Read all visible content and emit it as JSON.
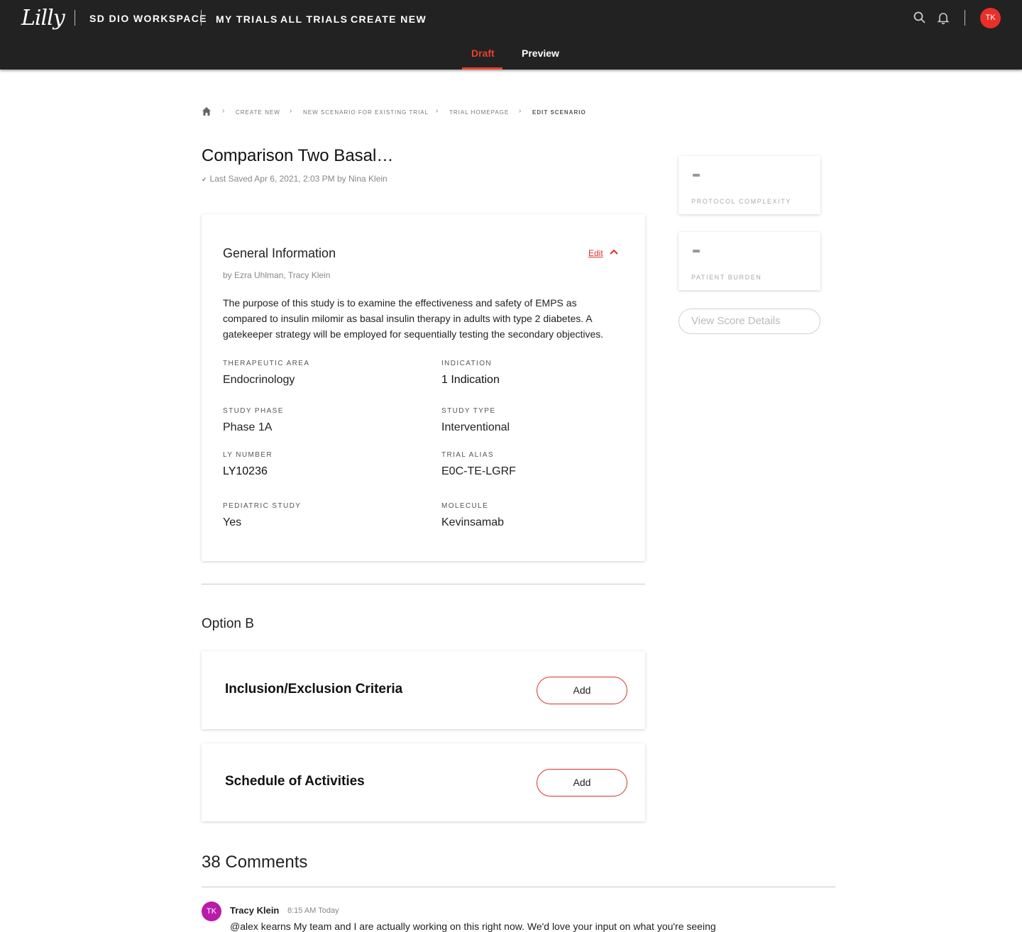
{
  "header": {
    "logo_text": "Lilly",
    "workspace": "SD DIO WORKSPACE",
    "nav": [
      "MY TRIALS",
      "ALL TRIALS",
      "CREATE NEW"
    ],
    "user_initials": "TK",
    "tabs": [
      "Draft",
      "Preview"
    ],
    "active_tab": "Draft"
  },
  "breadcrumb": [
    "CREATE NEW",
    "NEW SCENARIO FOR EXISTING TRIAL",
    "TRIAL HOMEPAGE",
    "EDIT SCENARIO"
  ],
  "page": {
    "title": "Comparison Two Basal…",
    "saved": "Last Saved Apr 6, 2021, 2:03 PM by Nina Klein"
  },
  "general_info": {
    "title": "General Information",
    "edit_label": "Edit",
    "by": "by Ezra Uhlman, Tracy Klein",
    "description": "The purpose of this study is to examine the effectiveness and safety of EMPS as compared to insulin milomir as basal insulin therapy in adults with type 2 diabetes. A gatekeeper strategy will be employed for sequentially testing the secondary objectives.",
    "fields": {
      "therapeutic_area": {
        "label": "THERAPEUTIC AREA",
        "value": "Endocrinology"
      },
      "indication": {
        "label": "INDICATION",
        "value": "1 Indication"
      },
      "study_phase": {
        "label": "STUDY PHASE",
        "value": "Phase 1A"
      },
      "study_type": {
        "label": "STUDY TYPE",
        "value": "Interventional"
      },
      "ly_number": {
        "label": "LY NUMBER",
        "value": "LY10236"
      },
      "trial_alias": {
        "label": "TRIAL ALIAS",
        "value": "E0C-TE-LGRF"
      },
      "pediatric_study": {
        "label": "PEDIATRIC STUDY",
        "value": "Yes"
      },
      "molecule": {
        "label": "MOLECULE",
        "value": "Kevinsamab"
      }
    }
  },
  "option": {
    "title": "Option B",
    "sections": [
      {
        "title": "Inclusion/Exclusion Criteria",
        "button": "Add"
      },
      {
        "title": "Schedule of Activities",
        "button": "Add"
      }
    ]
  },
  "scores": {
    "cards": [
      {
        "value": "-",
        "label": "PROTOCOL COMPLEXITY"
      },
      {
        "value": "-",
        "label": "PATIENT BURDEN"
      }
    ],
    "details_button": "View Score Details"
  },
  "comments": {
    "title": "38 Comments",
    "items": [
      {
        "initials": "TK",
        "name": "Tracy Klein",
        "time": "8:15 AM Today",
        "text": "@alex kearns My team and I are actually working on this right now. We'd love your input on what you're seeing"
      }
    ]
  },
  "colors": {
    "accent": "#e8402d",
    "topbar": "#222222",
    "comment_avatar": "#b81ca8"
  }
}
